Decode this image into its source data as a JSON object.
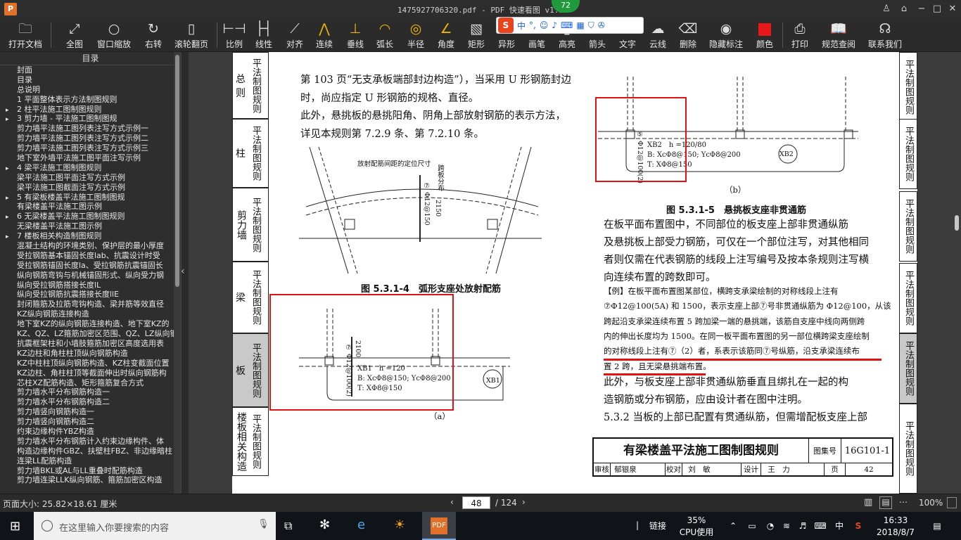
{
  "window": {
    "title": "1475927706320.pdf - PDF 快速看图 v1.9",
    "app_icon": "P"
  },
  "cpu_badge": "72",
  "ime": {
    "logo": "S",
    "mode": "中",
    "punct": "°,"
  },
  "toolbar": {
    "open": "打开文档",
    "full": "全图",
    "window_zoom": "窗口缩放",
    "rotate": "右转",
    "scroll_page": "滚轮翻页",
    "ratio": "比例",
    "linear": "线性",
    "align": "对齐",
    "continuous": "连续",
    "perpendicular": "垂线",
    "arc_length": "弧长",
    "radius": "半径",
    "angle": "角度",
    "rectangle": "矩形",
    "irregular": "异形",
    "brush": "画笔",
    "height": "高亮",
    "arrow": "箭头",
    "text": "文字",
    "cloud": "云线",
    "delete": "删除",
    "hide_marks": "隐藏标注",
    "color": "颜色",
    "print": "打印",
    "spec_query": "规范查阅",
    "contact": "联系我们"
  },
  "sidebar": {
    "title": "目录",
    "items": [
      {
        "arrow": "",
        "text": "封面"
      },
      {
        "arrow": "",
        "text": "目录"
      },
      {
        "arrow": "",
        "text": "总说明"
      },
      {
        "arrow": "",
        "text": "1 平面整体表示方法制图规则"
      },
      {
        "arrow": "▸",
        "text": "2 柱平法施工图制图规则"
      },
      {
        "arrow": "▸",
        "text": "3 剪力墙 - 平法施工图制图规"
      },
      {
        "arrow": "",
        "text": "剪力墙平法施工图列表注写方式示例一"
      },
      {
        "arrow": "",
        "text": "剪力墙平法施工图列表注写方式示例二"
      },
      {
        "arrow": "",
        "text": "剪力墙平法施工图列表注写方式示例三"
      },
      {
        "arrow": "",
        "text": "地下室外墙平法施工图平面注写示例"
      },
      {
        "arrow": "▸",
        "text": "4 梁平法施工图制图规则"
      },
      {
        "arrow": "",
        "text": "梁平法施工图平面注写方式示例"
      },
      {
        "arrow": "",
        "text": "梁平法施工图截面注写方式示例"
      },
      {
        "arrow": "▸",
        "text": "5 有梁板楼盖平法施工图制图规"
      },
      {
        "arrow": "",
        "text": "有梁楼盖平法施工图示例"
      },
      {
        "arrow": "▸",
        "text": "6 无梁楼盖平法施工图制图规则"
      },
      {
        "arrow": "",
        "text": "无梁楼盖平法施工图示例"
      },
      {
        "arrow": "▸",
        "text": "7 楼板相关构造制图规则"
      },
      {
        "arrow": "",
        "text": "混凝土结构的环境类别、保护层的最小厚度"
      },
      {
        "arrow": "",
        "text": "受拉钢筋基本锚固长度lab、抗震设计时受"
      },
      {
        "arrow": "",
        "text": "受拉钢筋锚固长度la、受拉钢筋抗震锚固长"
      },
      {
        "arrow": "",
        "text": "纵向钢筋弯钩与机械锚固形式、纵向受力钢"
      },
      {
        "arrow": "",
        "text": "纵向受拉钢筋搭接长度lL"
      },
      {
        "arrow": "",
        "text": "纵向受拉钢筋抗震搭接长度llE"
      },
      {
        "arrow": "",
        "text": "封闭箍筋及拉筋弯钩构造、梁并筋等效直径"
      },
      {
        "arrow": "",
        "text": "KZ纵向钢筋连接构造"
      },
      {
        "arrow": "",
        "text": "地下室KZ的纵向钢筋连接构造、地下室KZ的"
      },
      {
        "arrow": "",
        "text": "KZ、QZ、LZ箍筋加密区范围、QZ、LZ纵向钢"
      },
      {
        "arrow": "",
        "text": "抗震框架柱和小墙肢箍筋加密区高度选用表"
      },
      {
        "arrow": "",
        "text": "KZ边柱和角柱柱顶纵向钢筋构造"
      },
      {
        "arrow": "",
        "text": "KZ中柱柱顶纵向钢筋构造、KZ柱变截面位置"
      },
      {
        "arrow": "",
        "text": "KZ边柱、角柱柱顶等截面伸出时纵向钢筋构"
      },
      {
        "arrow": "",
        "text": "芯柱XZ配筋构造、矩形箍筋复合方式"
      },
      {
        "arrow": "",
        "text": "剪力墙水平分布钢筋构造一"
      },
      {
        "arrow": "",
        "text": "剪力墙水平分布钢筋构造二"
      },
      {
        "arrow": "",
        "text": "剪力墙竖向钢筋构造一"
      },
      {
        "arrow": "",
        "text": "剪力墙竖向钢筋构造二"
      },
      {
        "arrow": "",
        "text": "约束边缘构件YBZ构造"
      },
      {
        "arrow": "",
        "text": "剪力墙水平分布钢筋计入约束边缘构件、体"
      },
      {
        "arrow": "",
        "text": "构造边缘构件GBZ、扶壁柱FBZ、非边缘暗柱"
      },
      {
        "arrow": "",
        "text": "连梁LL配筋构造"
      },
      {
        "arrow": "",
        "text": "剪力墙BKL或AL与LL重叠时配筋构造"
      },
      {
        "arrow": "",
        "text": "剪力墙连梁LLK纵向钢筋、箍筋加密区构造"
      }
    ]
  },
  "page": {
    "left_tabs": [
      {
        "a": "总则",
        "b": "平法制图规则"
      },
      {
        "a": "柱",
        "b": "平法制图规则"
      },
      {
        "a": "剪力墙",
        "b": "平法制图规则"
      },
      {
        "a": "梁",
        "b": "平法制图规则"
      },
      {
        "a": "板",
        "b": "平法制图规则"
      },
      {
        "a": "楼板相关构造",
        "b": "平法制图规则"
      }
    ],
    "right_tabs": [
      "平法制图规则",
      "平法制图规则",
      "平法制图规则",
      "平法制图规则",
      "平法制图规则",
      "平法制图规则"
    ],
    "left_para": [
      "第 103 页“无支承板端部封边构造”），当采用 U 形钢筋封边",
      "时，尚应指定 U 形钢筋的规格、直径。",
      "    此外，悬挑板的悬挑阳角、阴角上部放射钢筋的表示方法，",
      "详见本规则第 7.2.9 条、第 7.2.10 条。"
    ],
    "fig4": {
      "note": "放射配筋间距的定位尺寸",
      "bar": "⑦ Φ12@150",
      "len": "2150",
      "dist": "跨板分布",
      "caption": "图 5.3.1-4　弧形支座处放射配筋"
    },
    "figa": {
      "bar": "⑦ Φ12@100(2)",
      "dim": "2100",
      "line1": "XB1　h =120",
      "line2": "B: XcΦ8@150; YcΦ8@200",
      "line3": "T: XΦ8@150",
      "tag": "XB1",
      "label": "（a）"
    },
    "figb": {
      "bar": "⑤ Φ12@100(2)",
      "line1": "XB2　h =120/80",
      "line2": "B: XcΦ8@150; YcΦ8@200",
      "line3": "T: XΦ8@150",
      "tag": "XB2",
      "label": "（b）"
    },
    "fig5_caption": "图 5.3.1-5　悬挑板支座非贯通筋",
    "right_para": [
      "    在板平面布置图中，不同部位的板支座上部非贯通纵筋",
      "及悬挑板上部受力钢筋，可仅在一个部位注写，对其他相同",
      "者则仅需在代表钢筋的线段上注写编号及按本条规则注写横",
      "向连续布置的跨数即可。"
    ],
    "example": [
      "    【例】在板平面布置图某部位，横跨支承梁绘制的对称线段上注有",
      "⑦Φ12@100(5A) 和 1500，表示支座上部⑦号非贯通纵筋为 Φ12@100，从该",
      "跨起沿支承梁连续布置 5 跨加梁一端的悬挑端，该筋自支座中线向两侧跨",
      "内的伸出长度均为 1500。在同一板平面布置图的另一部位横跨梁支座绘制",
      "的对称线段上注有⑦（2）者，系表示该筋同⑦号纵筋，沿支承梁连续布",
      "置 2 跨，且无梁悬挑端布置。"
    ],
    "after_para": [
      "    此外，与板支座上部非贯通纵筋垂直且绑扎在一起的构",
      "造钢筋或分布钢筋，应由设计者在图中注明。",
      "5.3.2  当板的上部已配置有贯通纵筋，但需增配板支座上部"
    ],
    "titleblock": {
      "title": "有梁楼盖平法施工图制图规则",
      "set_label": "图集号",
      "set_no": "16G101-1",
      "audit": "审核",
      "audit_name": "郁银泉",
      "check": "校对",
      "check_name": "刘　敏",
      "design": "设计",
      "design_name": "王　力",
      "page_label": "页",
      "page_no": "42"
    }
  },
  "status": {
    "size_label": "页面大小: 25.82×18.61 厘米",
    "current_page": "48",
    "total_pages": "/ 124",
    "zoom": "100%"
  },
  "taskbar": {
    "search_placeholder": "在这里输入你要搜索的内容",
    "link_label": "链接",
    "cpu_pct": "35%",
    "cpu_label": "CPU使用",
    "ime_lang": "中",
    "time": "16:33",
    "date": "2018/8/7"
  }
}
